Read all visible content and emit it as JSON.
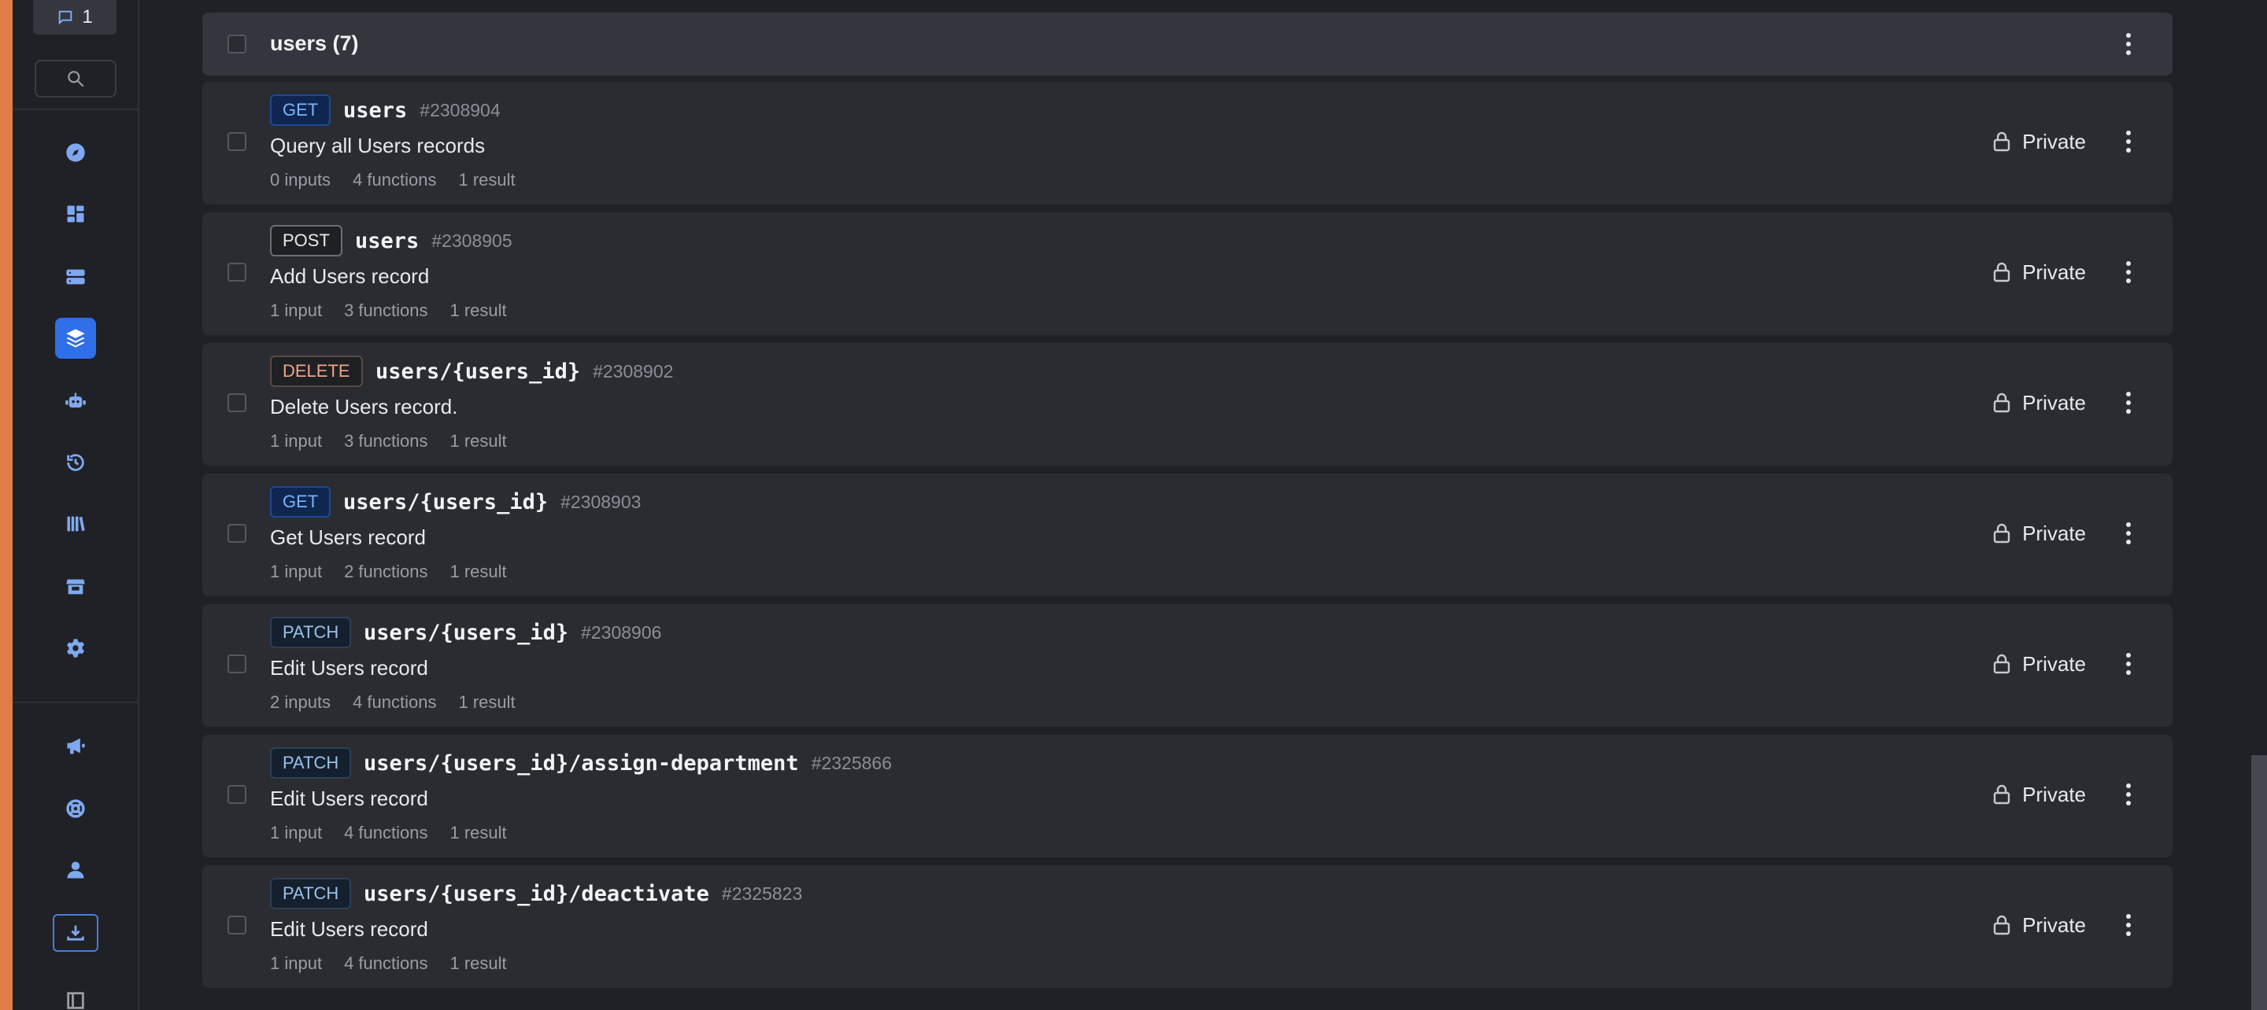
{
  "sidebar": {
    "comment_count": "1",
    "icons": [
      "compass-icon",
      "dashboard-icon",
      "database-icon",
      "layers-icon",
      "robot-icon",
      "history-icon",
      "library-icon",
      "marketplace-icon",
      "settings-icon",
      "megaphone-icon",
      "support-icon",
      "user-icon",
      "download-icon",
      "docs-icon"
    ],
    "accent_color": "#2f6fe8"
  },
  "group": {
    "title": "users (7)"
  },
  "endpoints": [
    {
      "method": "GET",
      "path": "users",
      "id": "#2308904",
      "description": "Query all Users records",
      "inputs": "0 inputs",
      "functions": "4 functions",
      "results": "1 result",
      "privacy": "Private"
    },
    {
      "method": "POST",
      "path": "users",
      "id": "#2308905",
      "description": "Add Users record",
      "inputs": "1 input",
      "functions": "3 functions",
      "results": "1 result",
      "privacy": "Private"
    },
    {
      "method": "DELETE",
      "path": "users/{users_id}",
      "id": "#2308902",
      "description": "Delete Users record.",
      "inputs": "1 input",
      "functions": "3 functions",
      "results": "1 result",
      "privacy": "Private"
    },
    {
      "method": "GET",
      "path": "users/{users_id}",
      "id": "#2308903",
      "description": "Get Users record",
      "inputs": "1 input",
      "functions": "2 functions",
      "results": "1 result",
      "privacy": "Private"
    },
    {
      "method": "PATCH",
      "path": "users/{users_id}",
      "id": "#2308906",
      "description": "Edit Users record",
      "inputs": "2 inputs",
      "functions": "4 functions",
      "results": "1 result",
      "privacy": "Private"
    },
    {
      "method": "PATCH",
      "path": "users/{users_id}/assign-department",
      "id": "#2325866",
      "description": "Edit Users record",
      "inputs": "1 input",
      "functions": "4 functions",
      "results": "1 result",
      "privacy": "Private"
    },
    {
      "method": "PATCH",
      "path": "users/{users_id}/deactivate",
      "id": "#2325823",
      "description": "Edit Users record",
      "inputs": "1 input",
      "functions": "4 functions",
      "results": "1 result",
      "privacy": "Private"
    }
  ]
}
